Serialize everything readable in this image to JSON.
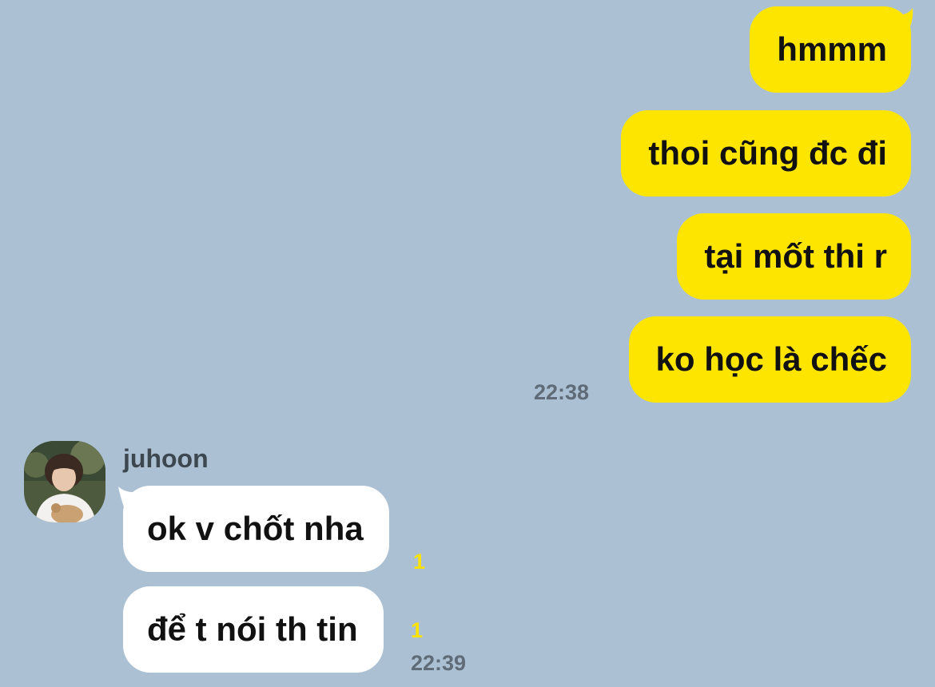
{
  "conversation": {
    "sent_messages": [
      {
        "text": "hmmm"
      },
      {
        "text": "thoi cũng đc đi"
      },
      {
        "text": "tại mốt thi r"
      },
      {
        "text": "ko học là chếc"
      }
    ],
    "sent_time": "22:38",
    "contact": {
      "name": "juhoon"
    },
    "received_messages": [
      {
        "text": "ok v chốt nha",
        "unread": "1"
      },
      {
        "text": "để t nói th tin",
        "unread": "1"
      }
    ],
    "received_time": "22:39"
  },
  "colors": {
    "background": "#abc1d3",
    "sent_bubble": "#fee500",
    "received_bubble": "#ffffff",
    "unread_count": "#fde100",
    "timestamp": "#5f6c78"
  }
}
